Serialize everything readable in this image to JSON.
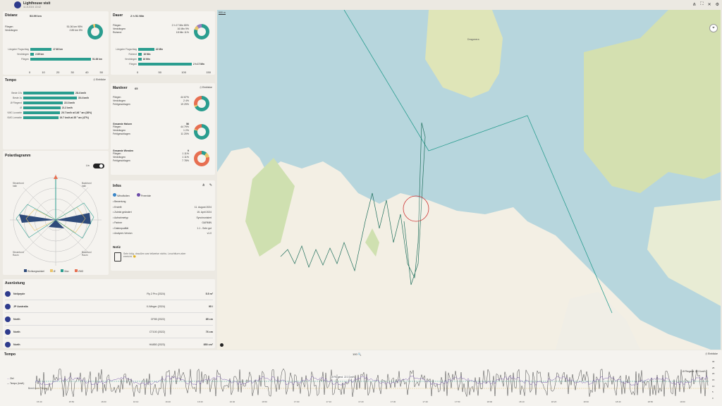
{
  "app": {
    "title": "Lighthouse visit",
    "subtitle": "11.8.2024 13:42",
    "icons": [
      "share-icon",
      "crop-icon",
      "close-icon",
      "settings-icon"
    ]
  },
  "distance": {
    "title": "Distanz",
    "total": "53.99 km",
    "rows": [
      {
        "label": "Fliegen",
        "value": "51.06 km",
        "pct": "95%"
      },
      {
        "label": "Verdrängen",
        "value": "2.85 km",
        "pct": "5%"
      }
    ],
    "bars": [
      {
        "label": "Längster Flugschlag",
        "value": "17.66 km",
        "frac": 0.35
      },
      {
        "label": "Verdrängen",
        "value": "2.85 km",
        "frac": 0.06
      },
      {
        "label": "Fliegen",
        "value": "51.06 km",
        "frac": 1.0
      }
    ],
    "ticks": [
      "0",
      "10",
      "20",
      "30",
      "40",
      "50"
    ]
  },
  "duration": {
    "title": "Dauer",
    "total": "2 h 51 Min",
    "rows": [
      {
        "label": "Fliegen",
        "value": "2 h 17 Min",
        "pct": "80%"
      },
      {
        "label": "Verdrängen",
        "value": "16 Min",
        "pct": "9%"
      },
      {
        "label": "Ruhend",
        "value": "18 Min",
        "pct": "11%"
      }
    ],
    "bars": [
      {
        "label": "Längster Flugschlag",
        "value": "42 Min",
        "frac": 0.3
      },
      {
        "label": "Ruhend",
        "value": "18 Min",
        "frac": 0.07
      },
      {
        "label": "Verdrängen",
        "value": "16 Min",
        "frac": 0.06
      },
      {
        "label": "Fliegen",
        "value": "2 h 17 Min",
        "frac": 1.0
      }
    ],
    "ticks": [
      "0",
      "50",
      "100",
      "150"
    ]
  },
  "speed": {
    "title": "Tempo",
    "export_label": "Einblicke",
    "bars": [
      {
        "label": "Beste 10s",
        "value": "28.4 km/h",
        "frac": 0.9
      },
      {
        "label": "Beste 1s",
        "value": "30.4 km/h",
        "frac": 0.95
      },
      {
        "label": "Ø Fliegend",
        "value": "22.3 km/h",
        "frac": 0.7
      },
      {
        "label": "Ø",
        "value": "21.2 km/h",
        "frac": 0.66
      },
      {
        "label": "VMG Luvseite",
        "value": "20.7 km/h at 146 ° arc (38%)",
        "frac": 0.65
      },
      {
        "label": "VMG Leeseite",
        "value": "19.7 km/h at 35 ° arc (47%)",
        "frac": 0.62
      }
    ]
  },
  "polar": {
    "title": "Polardiagramm",
    "toggle_label": "Lin",
    "labels": [
      "Steuerbord\nhalb",
      "Backbord\nhalb",
      "Steuerbord\nRaum",
      "Backbord\nRaum"
    ],
    "legend": [
      {
        "label": "Richtungswinkel",
        "color": "#2e4a7a"
      },
      {
        "label": "Ø",
        "color": "#e9c46a"
      },
      {
        "label": "Max",
        "color": "#2a9d8f"
      },
      {
        "label": "VMG",
        "color": "#e76f51"
      }
    ]
  },
  "maneuvers": {
    "title": "Manöver",
    "count": "65",
    "export_label": "Einblicke",
    "groups": [
      {
        "title": "",
        "total": "",
        "rows": [
          {
            "label": "Fliegen",
            "value": "44",
            "pct": "67%"
          },
          {
            "label": "Verdrängen",
            "value": "2",
            "pct": "4%"
          },
          {
            "label": "Fehlgeschlagen",
            "value": "19",
            "pct": "29%"
          }
        ]
      },
      {
        "title": "Gesamte Halsen",
        "total": "56",
        "rows": [
          {
            "label": "Fliegen",
            "value": "44",
            "pct": "79%"
          },
          {
            "label": "Verdrängen",
            "value": "1",
            "pct": "2%"
          },
          {
            "label": "Fehlgeschlagen",
            "value": "11",
            "pct": "20%"
          }
        ]
      },
      {
        "title": "Gesamte Wenden",
        "total": "9",
        "rows": [
          {
            "label": "Fliegen",
            "value": "1",
            "pct": "11%"
          },
          {
            "label": "Verdrängen",
            "value": "1",
            "pct": "11%"
          },
          {
            "label": "Fehlgeschlagen",
            "value": "7",
            "pct": "78%"
          }
        ]
      }
    ]
  },
  "info": {
    "title": "Infos",
    "users": [
      "Windfoilen",
      "Freeride"
    ],
    "rows": [
      {
        "label": "Bewertung",
        "value": ""
      },
      {
        "label": "Erstellt",
        "value": "11. August 2024"
      },
      {
        "label": "Zuletzt geändert",
        "value": "15. April 2024"
      },
      {
        "label": "Aufnahmetyp",
        "value": "Synchronisiert"
      },
      {
        "label": "Partner",
        "value": "GARMIN"
      },
      {
        "label": "Datenqualität",
        "value": "1.1 - Sehr gut"
      },
      {
        "label": "Analyzer-Version",
        "value": "v1.0"
      }
    ],
    "notes_title": "Notiz",
    "notes_text": "Sehr böig, draußen war teilweise nichts. Leuchtturm aber erreicht. 😊"
  },
  "equipment": {
    "title": "Ausrüstung",
    "rows": [
      {
        "brand": "Neilpryde",
        "model": "Fly 2 Pro (2024)",
        "size": "5.5 m²"
      },
      {
        "brand": "JP Australia",
        "model": "X-Winger (2024)",
        "size": "95 l"
      },
      {
        "brand": "North",
        "model": "CF85 (2022)",
        "size": "85 cm"
      },
      {
        "brand": "North",
        "model": "CT100 (2022)",
        "size": "76 cm"
      },
      {
        "brand": "North",
        "model": "HA850 (2023)",
        "size": "850 cm²"
      }
    ]
  },
  "map": {
    "zoom_label": "100 🔍",
    "scale": "500 m",
    "label_island": "Dragonera"
  },
  "bottom": {
    "title": "Tempo",
    "export_label": "Einblicke",
    "legend": [
      "Ziel",
      "Tempo (km/h)"
    ],
    "annotations": [
      "Ø Fliegend: 22.3 km/h",
      "Ø Fliegend: 22.3 km/h",
      "Ø Fliegend: 22.3 km/h"
    ],
    "line_label": "Bereit zum Fliegen",
    "yticks": [
      "30",
      "25",
      "20",
      "15",
      "10",
      "5",
      "0"
    ],
    "xticks": [
      "15:40",
      "15:50",
      "16:00",
      "16:10",
      "16:20",
      "16:30",
      "16:40",
      "16:50",
      "17:00",
      "17:10",
      "17:20",
      "17:30",
      "17:40",
      "17:50",
      "18:00",
      "18:10",
      "18:20",
      "18:30",
      "18:40",
      "18:50",
      "19:00"
    ]
  }
}
